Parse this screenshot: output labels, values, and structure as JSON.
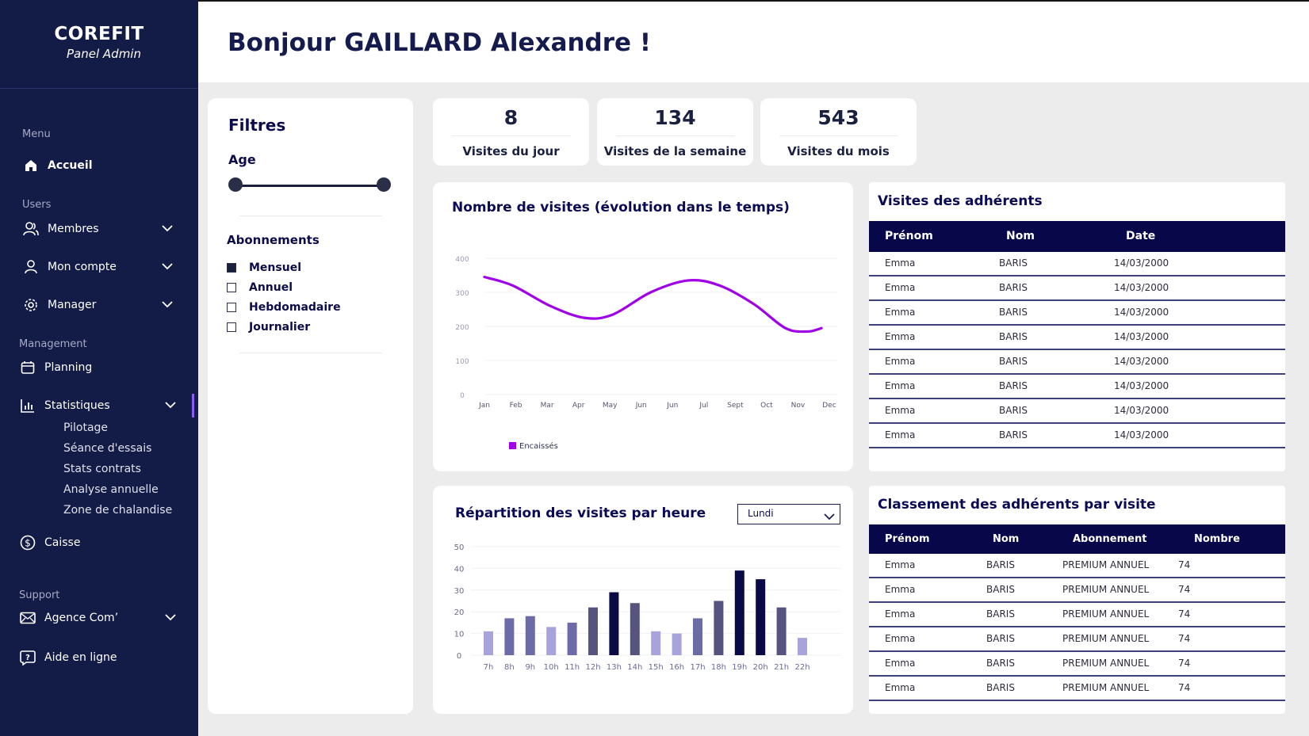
{
  "brand": {
    "title": "COREFIT",
    "subtitle": "Panel Admin"
  },
  "greeting": "Bonjour GAILLARD Alexandre !",
  "sidebar": {
    "sections": {
      "menu": "Menu",
      "users": "Users",
      "management": "Management",
      "support": "Support"
    },
    "items": {
      "accueil": "Accueil",
      "membres": "Membres",
      "compte": "Mon compte",
      "manager": "Manager",
      "planning": "Planning",
      "statistiques": "Statistiques",
      "caisse": "Caisse",
      "agence": "Agence Com’",
      "aide": "Aide en ligne"
    },
    "stats_sub": [
      "Pilotage",
      "Séance d'essais",
      "Stats contrats",
      "Analyse annuelle",
      "Zone de chalandise"
    ]
  },
  "filters": {
    "title": "Filtres",
    "age_label": "Age",
    "abonnements_title": "Abonnements",
    "options": [
      {
        "label": "Mensuel",
        "checked": true
      },
      {
        "label": "Annuel",
        "checked": false
      },
      {
        "label": "Hebdomadaire",
        "checked": false
      },
      {
        "label": "Journalier",
        "checked": false
      }
    ]
  },
  "stats": [
    {
      "value": "8",
      "label": "Visites du jour"
    },
    {
      "value": "134",
      "label": "Visites de la semaine"
    },
    {
      "value": "543",
      "label": "Visites du mois"
    }
  ],
  "chart_data": [
    {
      "type": "line",
      "title": "Nombre de visites (évolution dans le temps)",
      "x": [
        "Jan",
        "Feb",
        "Mar",
        "Apr",
        "May",
        "Jun",
        "Jun",
        "Jul",
        "Sept",
        "Oct",
        "Nov",
        "Dec"
      ],
      "ylim": [
        0,
        400
      ],
      "yticks": [
        0,
        100,
        200,
        300,
        400
      ],
      "grid": true,
      "series": [
        {
          "name": "Encaissés",
          "color": "#a000e8",
          "points": [
            [
              0,
              345
            ],
            [
              0.9,
              320
            ],
            [
              2.1,
              260
            ],
            [
              3.2,
              225
            ],
            [
              4.1,
              235
            ],
            [
              5.3,
              300
            ],
            [
              6.5,
              335
            ],
            [
              7.5,
              320
            ],
            [
              8.6,
              265
            ],
            [
              9.6,
              195
            ],
            [
              10.3,
              185
            ],
            [
              10.75,
              195
            ]
          ]
        }
      ],
      "legend": "bottom-left"
    },
    {
      "type": "bar",
      "title": "Répartition des visites par heure",
      "categories": [
        "7h",
        "8h",
        "9h",
        "10h",
        "11h",
        "12h",
        "13h",
        "14h",
        "15h",
        "16h",
        "17h",
        "18h",
        "19h",
        "20h",
        "21h",
        "22h"
      ],
      "values": [
        11,
        17,
        18,
        13,
        15,
        22,
        29,
        24,
        11,
        10,
        17,
        25,
        39,
        35,
        22,
        8
      ],
      "ylim": [
        0,
        50
      ],
      "yticks": [
        0,
        10,
        20,
        30,
        40,
        50
      ],
      "grid": true,
      "bar_colors": [
        "#a7a4dc",
        "#6d6aa8",
        "#6d6aa8",
        "#a7a4dc",
        "#6d6aa8",
        "#55547f",
        "#0a0a45",
        "#55547f",
        "#a7a4dc",
        "#a7a4dc",
        "#6d6aa8",
        "#55547f",
        "#0a0a45",
        "#0a0a45",
        "#55547f",
        "#a7a4dc"
      ]
    }
  ],
  "day_select": "Lundi",
  "visites_table": {
    "title": "Visites des adhérents",
    "headers": [
      "Prénom",
      "Nom",
      "Date"
    ],
    "rows": [
      [
        "Emma",
        "BARIS",
        "14/03/2000"
      ],
      [
        "Emma",
        "BARIS",
        "14/03/2000"
      ],
      [
        "Emma",
        "BARIS",
        "14/03/2000"
      ],
      [
        "Emma",
        "BARIS",
        "14/03/2000"
      ],
      [
        "Emma",
        "BARIS",
        "14/03/2000"
      ],
      [
        "Emma",
        "BARIS",
        "14/03/2000"
      ],
      [
        "Emma",
        "BARIS",
        "14/03/2000"
      ],
      [
        "Emma",
        "BARIS",
        "14/03/2000"
      ]
    ]
  },
  "classement_table": {
    "title": "Classement des adhérents par visite",
    "headers": [
      "Prénom",
      "Nom",
      "Abonnement",
      "Nombre"
    ],
    "rows": [
      [
        "Emma",
        "BARIS",
        "PREMIUM ANNUEL",
        "74"
      ],
      [
        "Emma",
        "BARIS",
        "PREMIUM ANNUEL",
        "74"
      ],
      [
        "Emma",
        "BARIS",
        "PREMIUM ANNUEL",
        "74"
      ],
      [
        "Emma",
        "BARIS",
        "PREMIUM ANNUEL",
        "74"
      ],
      [
        "Emma",
        "BARIS",
        "PREMIUM ANNUEL",
        "74"
      ],
      [
        "Emma",
        "BARIS",
        "PREMIUM ANNUEL",
        "74"
      ]
    ]
  }
}
